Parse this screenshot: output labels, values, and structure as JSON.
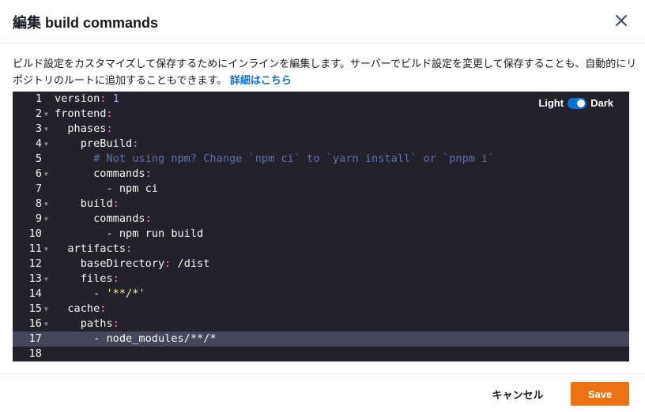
{
  "dialog": {
    "title": "編集 build commands",
    "description": "ビルド設定をカスタマイズして保存するためにインラインを編集します。サーバーでビルド設定を変更して保存することも、自動的にリポジトリのルートに追加することもできます。",
    "learn_more": "詳細はこちら"
  },
  "editor": {
    "theme_light": "Light",
    "theme_dark": "Dark",
    "dark_mode_on": true,
    "active_line": 17,
    "lines": [
      {
        "n": "1",
        "fold": false,
        "tokens": [
          [
            "",
            "version"
          ],
          [
            "punct",
            ":"
          ],
          [
            "",
            " "
          ],
          [
            "num",
            "1"
          ]
        ]
      },
      {
        "n": "2",
        "fold": true,
        "tokens": [
          [
            "",
            "frontend"
          ],
          [
            "punct",
            ":"
          ]
        ]
      },
      {
        "n": "3",
        "fold": true,
        "tokens": [
          [
            "",
            "  phases"
          ],
          [
            "punct",
            ":"
          ]
        ]
      },
      {
        "n": "4",
        "fold": true,
        "tokens": [
          [
            "",
            "    preBuild"
          ],
          [
            "punct",
            ":"
          ]
        ]
      },
      {
        "n": "5",
        "fold": false,
        "tokens": [
          [
            "",
            "      "
          ],
          [
            "comment",
            "# Not using npm? Change `npm ci` to `yarn install` or `pnpm i`"
          ]
        ]
      },
      {
        "n": "6",
        "fold": true,
        "tokens": [
          [
            "",
            "      commands"
          ],
          [
            "punct",
            ":"
          ]
        ]
      },
      {
        "n": "7",
        "fold": false,
        "tokens": [
          [
            "",
            "        - npm ci"
          ]
        ]
      },
      {
        "n": "8",
        "fold": true,
        "tokens": [
          [
            "",
            "    build"
          ],
          [
            "punct",
            ":"
          ]
        ]
      },
      {
        "n": "9",
        "fold": true,
        "tokens": [
          [
            "",
            "      commands"
          ],
          [
            "punct",
            ":"
          ]
        ]
      },
      {
        "n": "10",
        "fold": false,
        "tokens": [
          [
            "",
            "        - npm run build"
          ]
        ]
      },
      {
        "n": "11",
        "fold": true,
        "tokens": [
          [
            "",
            "  artifacts"
          ],
          [
            "punct",
            ":"
          ]
        ]
      },
      {
        "n": "12",
        "fold": false,
        "tokens": [
          [
            "",
            "    baseDirectory"
          ],
          [
            "punct",
            ":"
          ],
          [
            "",
            " /dist"
          ]
        ]
      },
      {
        "n": "13",
        "fold": true,
        "tokens": [
          [
            "",
            "    files"
          ],
          [
            "punct",
            ":"
          ]
        ]
      },
      {
        "n": "14",
        "fold": false,
        "tokens": [
          [
            "",
            "      - "
          ],
          [
            "str",
            "'**/*'"
          ]
        ]
      },
      {
        "n": "15",
        "fold": true,
        "tokens": [
          [
            "",
            "  cache"
          ],
          [
            "punct",
            ":"
          ]
        ]
      },
      {
        "n": "16",
        "fold": true,
        "tokens": [
          [
            "",
            "    paths"
          ],
          [
            "punct",
            ":"
          ]
        ]
      },
      {
        "n": "17",
        "fold": false,
        "tokens": [
          [
            "",
            "      - node_modules/**/*"
          ]
        ]
      },
      {
        "n": "18",
        "fold": false,
        "tokens": []
      }
    ]
  },
  "footer": {
    "cancel": "キャンセル",
    "save": "Save"
  }
}
